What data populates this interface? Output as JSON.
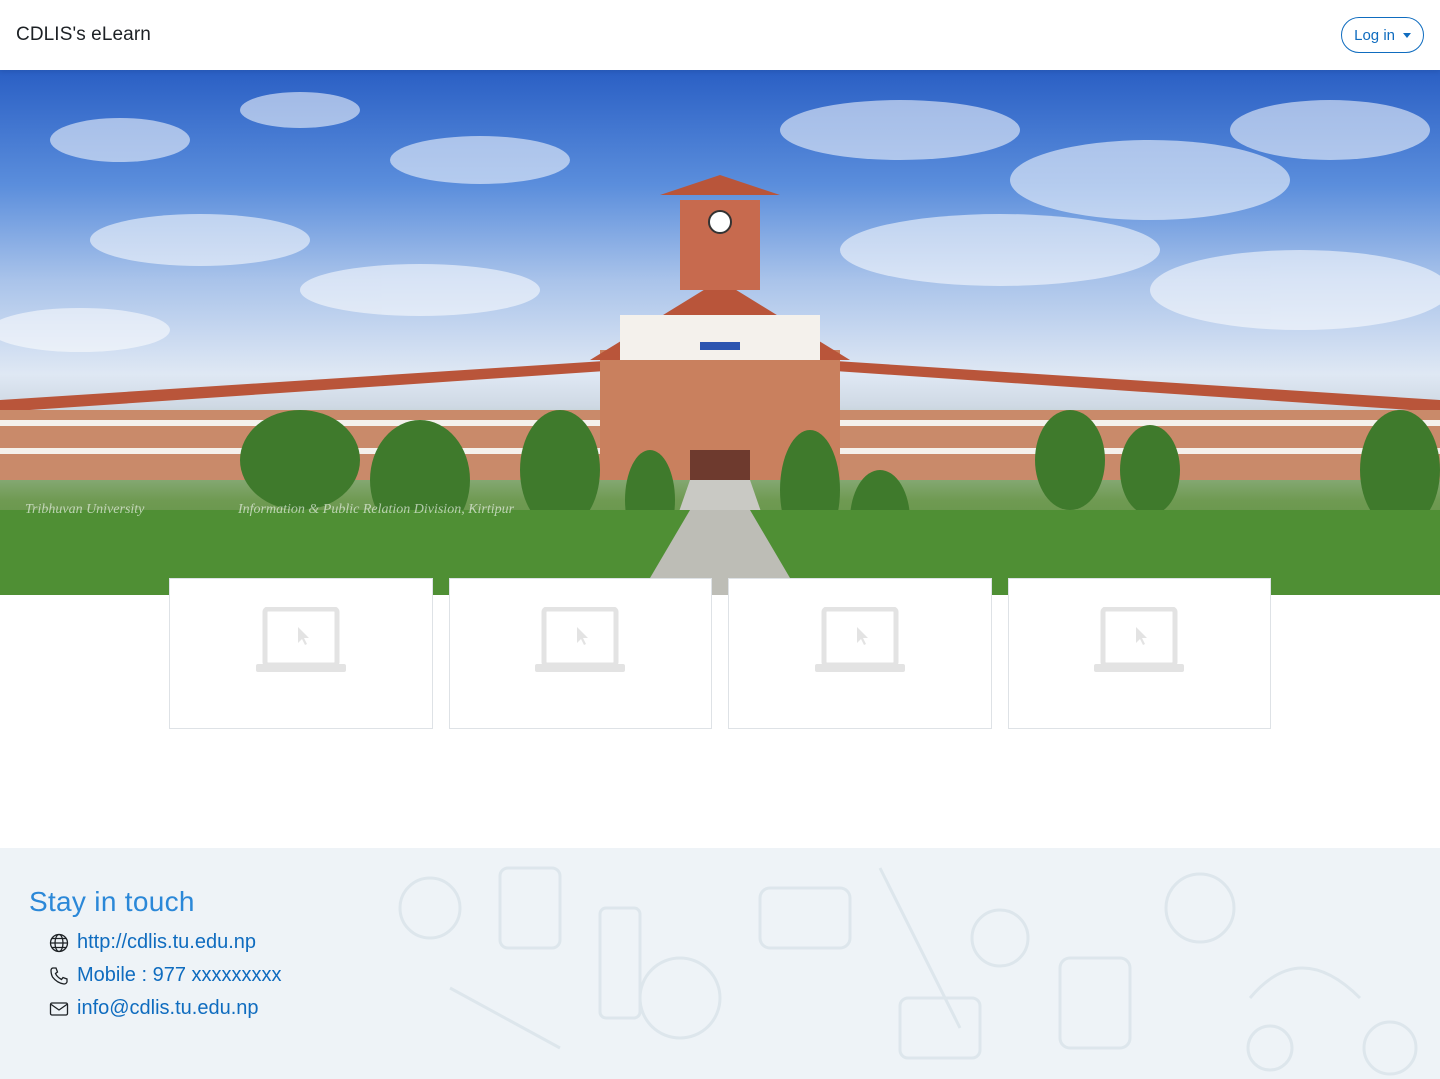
{
  "navbar": {
    "brand": "CDLIS's eLearn",
    "login_label": "Log in"
  },
  "hero": {
    "watermark_left": "Tribhuvan University",
    "watermark_right": "Information & Public Relation Division, Kirtipur"
  },
  "cards": [
    {
      "icon": "laptop-icon"
    },
    {
      "icon": "laptop-icon"
    },
    {
      "icon": "laptop-icon"
    },
    {
      "icon": "laptop-icon"
    }
  ],
  "footer": {
    "title": "Stay in touch",
    "website": "http://cdlis.tu.edu.np",
    "mobile": "Mobile : 977 xxxxxxxxx",
    "email": "info@cdlis.tu.edu.np"
  },
  "colors": {
    "accent": "#0f6cbf",
    "footer_title": "#2b88d8",
    "footer_bg": "#eef3f7"
  }
}
